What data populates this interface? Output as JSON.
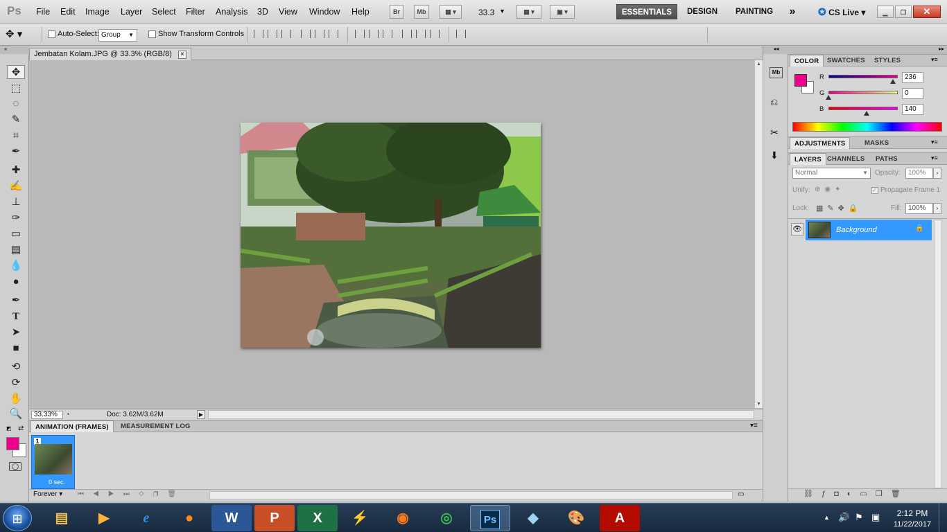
{
  "app": {
    "logo": "Ps"
  },
  "menu": [
    "File",
    "Edit",
    "Image",
    "Layer",
    "Select",
    "Filter",
    "Analysis",
    "3D",
    "View",
    "Window",
    "Help"
  ],
  "appbar": {
    "bridge": "Br",
    "minibridge": "Mb",
    "zoom": "33.3"
  },
  "workspaces": {
    "essentials": "ESSENTIALS",
    "design": "DESIGN",
    "painting": "PAINTING",
    "more": "»",
    "cslive": "CS Live"
  },
  "options": {
    "auto_select_label": "Auto-Select:",
    "auto_select_value": "Group",
    "transform_label": "Show Transform Controls"
  },
  "document": {
    "tab_title": "Jembatan Kolam.JPG @ 33.3% (RGB/8)",
    "close": "×"
  },
  "status": {
    "zoom": "33.33%",
    "doc": "Doc: 3.62M/3.62M"
  },
  "animation": {
    "tab_active": "ANIMATION (FRAMES)",
    "tab_other": "MEASUREMENT LOG",
    "frame_number": "1",
    "frame_delay": "0 sec.",
    "loop": "Forever"
  },
  "color_panel": {
    "tabs": [
      "COLOR",
      "SWATCHES",
      "STYLES"
    ],
    "r_label": "R",
    "g_label": "G",
    "b_label": "B",
    "r": "236",
    "g": "0",
    "b": "140",
    "r_level": 0.925,
    "g_level": 0.0,
    "b_level": 0.55,
    "foreground": "#ec008c",
    "background": "#ffffff"
  },
  "adjustments": {
    "tabs": [
      "ADJUSTMENTS",
      "MASKS"
    ]
  },
  "layers_panel": {
    "tabs": [
      "LAYERS",
      "CHANNELS",
      "PATHS"
    ],
    "blend_mode": "Normal",
    "opacity_label": "Opacity:",
    "opacity": "100%",
    "unify_label": "Unify:",
    "propagate_label": "Propagate Frame 1",
    "lock_label": "Lock:",
    "fill_label": "Fill:",
    "fill": "100%",
    "layer_name": "Background"
  },
  "taskbar": {
    "time": "2:12 PM",
    "date": "11/22/2017",
    "ps_label": "Ps"
  },
  "colors": {
    "accent": "#3399ff",
    "fg": "#ec008c",
    "taskbar": "#1e3350"
  }
}
